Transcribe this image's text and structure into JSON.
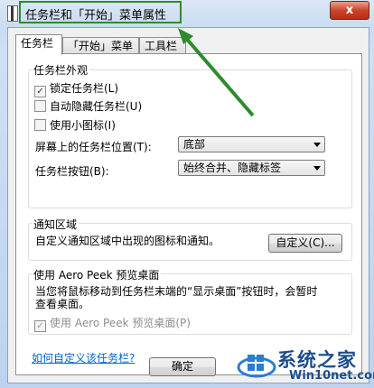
{
  "window": {
    "title": "任务栏和「开始」菜单属性",
    "close_label": "x"
  },
  "tabs": [
    {
      "label": "任务栏"
    },
    {
      "label": "「开始」菜单"
    },
    {
      "label": "工具栏"
    }
  ],
  "appearance": {
    "title": "任务栏外观",
    "lock": {
      "label": "锁定任务栏(L)",
      "checked": true
    },
    "autohide": {
      "label": "自动隐藏任务栏(U)",
      "checked": false
    },
    "small_icons": {
      "label": "使用小图标(I)",
      "checked": false
    },
    "location_label": "屏幕上的任务栏位置(T):",
    "location_value": "底部",
    "buttons_label": "任务栏按钮(B):",
    "buttons_value": "始终合并、隐藏标签"
  },
  "notification": {
    "title": "通知区域",
    "desc": "自定义通知区域中出现的图标和通知。",
    "customize_label": "自定义(C)..."
  },
  "peek": {
    "title": "使用 Aero Peek 预览桌面",
    "desc_line1": "当您将鼠标移动到任务栏末端的“显示桌面”按钮时，会暂时",
    "desc_line2": "查看桌面。",
    "checkbox_label": "使用 Aero Peek 预览桌面(P)",
    "checked": true
  },
  "help_link": "如何自定义该任务栏?",
  "ok_label": "确定",
  "watermark": {
    "main": "系统之家",
    "sub": "Win10net.com"
  },
  "colors": {
    "highlight": "#2e8b2e",
    "link": "#0066cc"
  }
}
